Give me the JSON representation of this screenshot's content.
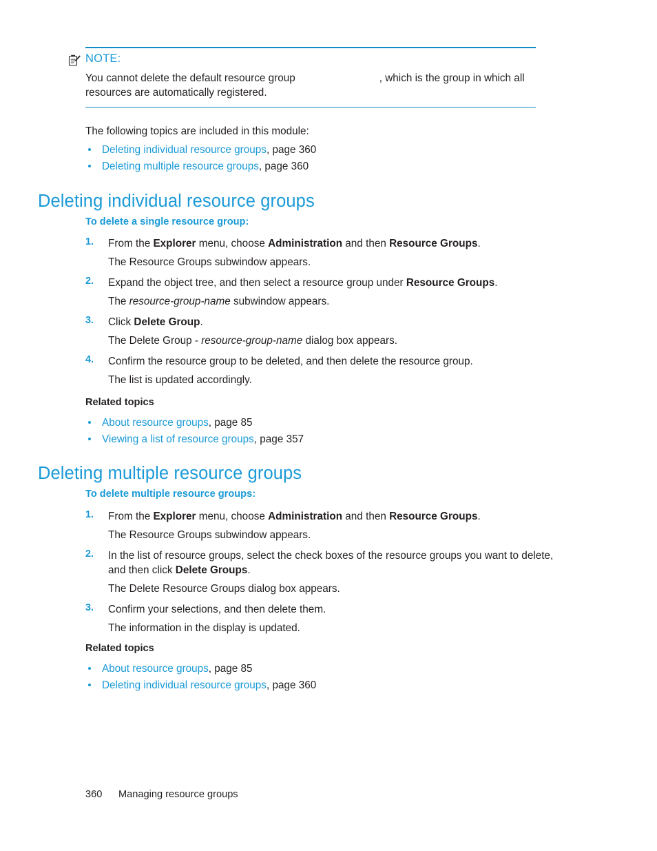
{
  "note": {
    "icon": "note-clipboard-icon",
    "label": "NOTE:",
    "body_before": "You cannot delete the default resource group",
    "body_after": ", which is the group in which all resources are automatically registered."
  },
  "intro": {
    "text": "The following topics are included in this module:"
  },
  "module_topics": [
    {
      "link": "Deleting individual resource groups",
      "suffix": ", page 360"
    },
    {
      "link": "Deleting multiple resource groups",
      "suffix": ", page 360"
    }
  ],
  "sections": [
    {
      "title": "Deleting individual resource groups",
      "subtitle": "To delete a single resource group:",
      "steps": [
        {
          "num": "1.",
          "parts": [
            {
              "t": "From the ",
              "s": "plain"
            },
            {
              "t": "Explorer",
              "s": "bold"
            },
            {
              "t": " menu, choose ",
              "s": "plain"
            },
            {
              "t": "Administration",
              "s": "bold"
            },
            {
              "t": " and then ",
              "s": "plain"
            },
            {
              "t": "Resource Groups",
              "s": "bold"
            },
            {
              "t": ".",
              "s": "plain"
            }
          ],
          "result_parts": [
            {
              "t": "The Resource Groups subwindow appears.",
              "s": "plain"
            }
          ]
        },
        {
          "num": "2.",
          "parts": [
            {
              "t": "Expand the object tree, and then select a resource group under ",
              "s": "plain"
            },
            {
              "t": "Resource Groups",
              "s": "bold"
            },
            {
              "t": ".",
              "s": "plain"
            }
          ],
          "result_parts": [
            {
              "t": "The ",
              "s": "plain"
            },
            {
              "t": "resource-group-name",
              "s": "italic"
            },
            {
              "t": " subwindow appears.",
              "s": "plain"
            }
          ]
        },
        {
          "num": "3.",
          "parts": [
            {
              "t": "Click ",
              "s": "plain"
            },
            {
              "t": "Delete Group",
              "s": "bold"
            },
            {
              "t": ".",
              "s": "plain"
            }
          ],
          "result_parts": [
            {
              "t": "The Delete Group - ",
              "s": "plain"
            },
            {
              "t": "resource-group-name",
              "s": "italic"
            },
            {
              "t": " dialog box appears.",
              "s": "plain"
            }
          ]
        },
        {
          "num": "4.",
          "parts": [
            {
              "t": "Confirm the resource group to be deleted, and then delete the resource group.",
              "s": "plain"
            }
          ],
          "result_parts": [
            {
              "t": "The list is updated accordingly.",
              "s": "plain"
            }
          ]
        }
      ],
      "related_head": "Related topics",
      "related": [
        {
          "link": "About resource groups",
          "suffix": ", page 85"
        },
        {
          "link": "Viewing a list of resource groups",
          "suffix": ", page 357"
        }
      ]
    },
    {
      "title": "Deleting multiple resource groups",
      "subtitle": "To delete multiple resource groups:",
      "steps": [
        {
          "num": "1.",
          "parts": [
            {
              "t": "From the ",
              "s": "plain"
            },
            {
              "t": "Explorer",
              "s": "bold"
            },
            {
              "t": " menu, choose ",
              "s": "plain"
            },
            {
              "t": "Administration",
              "s": "bold"
            },
            {
              "t": " and then ",
              "s": "plain"
            },
            {
              "t": "Resource Groups",
              "s": "bold"
            },
            {
              "t": ".",
              "s": "plain"
            }
          ],
          "result_parts": [
            {
              "t": "The Resource Groups subwindow appears.",
              "s": "plain"
            }
          ]
        },
        {
          "num": "2.",
          "parts": [
            {
              "t": "In the list of resource groups, select the check boxes of the resource groups you want to delete, and then click ",
              "s": "plain"
            },
            {
              "t": "Delete Groups",
              "s": "bold"
            },
            {
              "t": ".",
              "s": "plain"
            }
          ],
          "result_parts": [
            {
              "t": "The Delete Resource Groups dialog box appears.",
              "s": "plain"
            }
          ]
        },
        {
          "num": "3.",
          "parts": [
            {
              "t": "Confirm your selections, and then delete them.",
              "s": "plain"
            }
          ],
          "result_parts": [
            {
              "t": "The information in the display is updated.",
              "s": "plain"
            }
          ]
        }
      ],
      "related_head": "Related topics",
      "related": [
        {
          "link": "About resource groups",
          "suffix": ", page 85"
        },
        {
          "link": "Deleting individual resource groups",
          "suffix": ", page 360"
        }
      ]
    }
  ],
  "footer": {
    "page_number": "360",
    "chapter": "Managing resource groups"
  },
  "colors": {
    "accent": "#1a9ad7",
    "rule": "#0f8bc4",
    "text": "#231f20"
  }
}
